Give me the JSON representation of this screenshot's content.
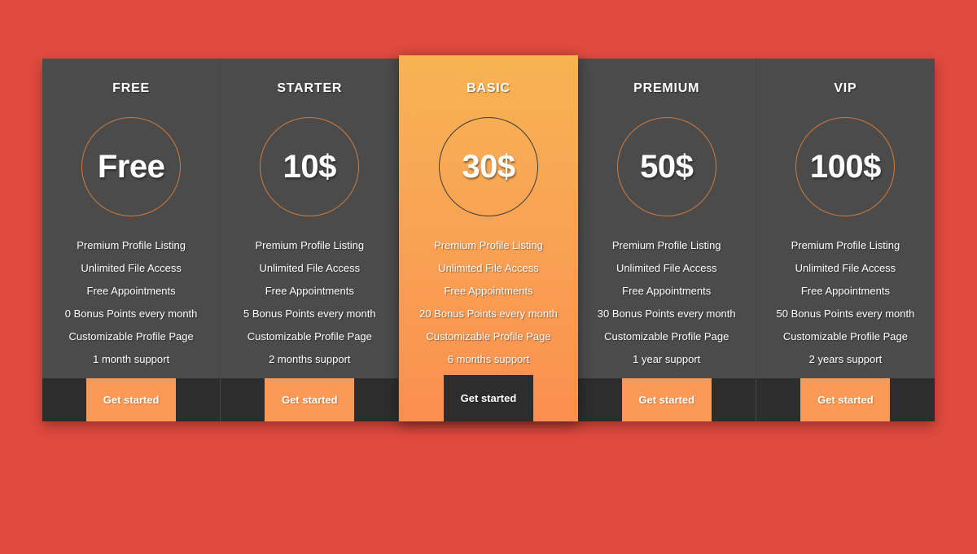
{
  "background_color": "#e04a3f",
  "accent_color": "#fb9a56",
  "card_color": "#4b4b4b",
  "footer_color": "#2d2d2d",
  "plans": [
    {
      "name": "FREE",
      "price": "Free",
      "featured": false,
      "cta_label": "Get started",
      "features": [
        "Premium Profile Listing",
        "Unlimited File Access",
        "Free Appointments",
        "0 Bonus Points every month",
        "Customizable Profile Page",
        "1 month support"
      ]
    },
    {
      "name": "STARTER",
      "price": "10$",
      "featured": false,
      "cta_label": "Get started",
      "features": [
        "Premium Profile Listing",
        "Unlimited File Access",
        "Free Appointments",
        "5 Bonus Points every month",
        "Customizable Profile Page",
        "2 months support"
      ]
    },
    {
      "name": "BASIC",
      "price": "30$",
      "featured": true,
      "cta_label": "Get started",
      "features": [
        "Premium Profile Listing",
        "Unlimited File Access",
        "Free Appointments",
        "20 Bonus Points every month",
        "Customizable Profile Page",
        "6 months support"
      ]
    },
    {
      "name": "PREMIUM",
      "price": "50$",
      "featured": false,
      "cta_label": "Get started",
      "features": [
        "Premium Profile Listing",
        "Unlimited File Access",
        "Free Appointments",
        "30 Bonus Points every month",
        "Customizable Profile Page",
        "1 year support"
      ]
    },
    {
      "name": "VIP",
      "price": "100$",
      "featured": false,
      "cta_label": "Get started",
      "features": [
        "Premium Profile Listing",
        "Unlimited File Access",
        "Free Appointments",
        "50 Bonus Points every month",
        "Customizable Profile Page",
        "2 years support"
      ]
    }
  ]
}
